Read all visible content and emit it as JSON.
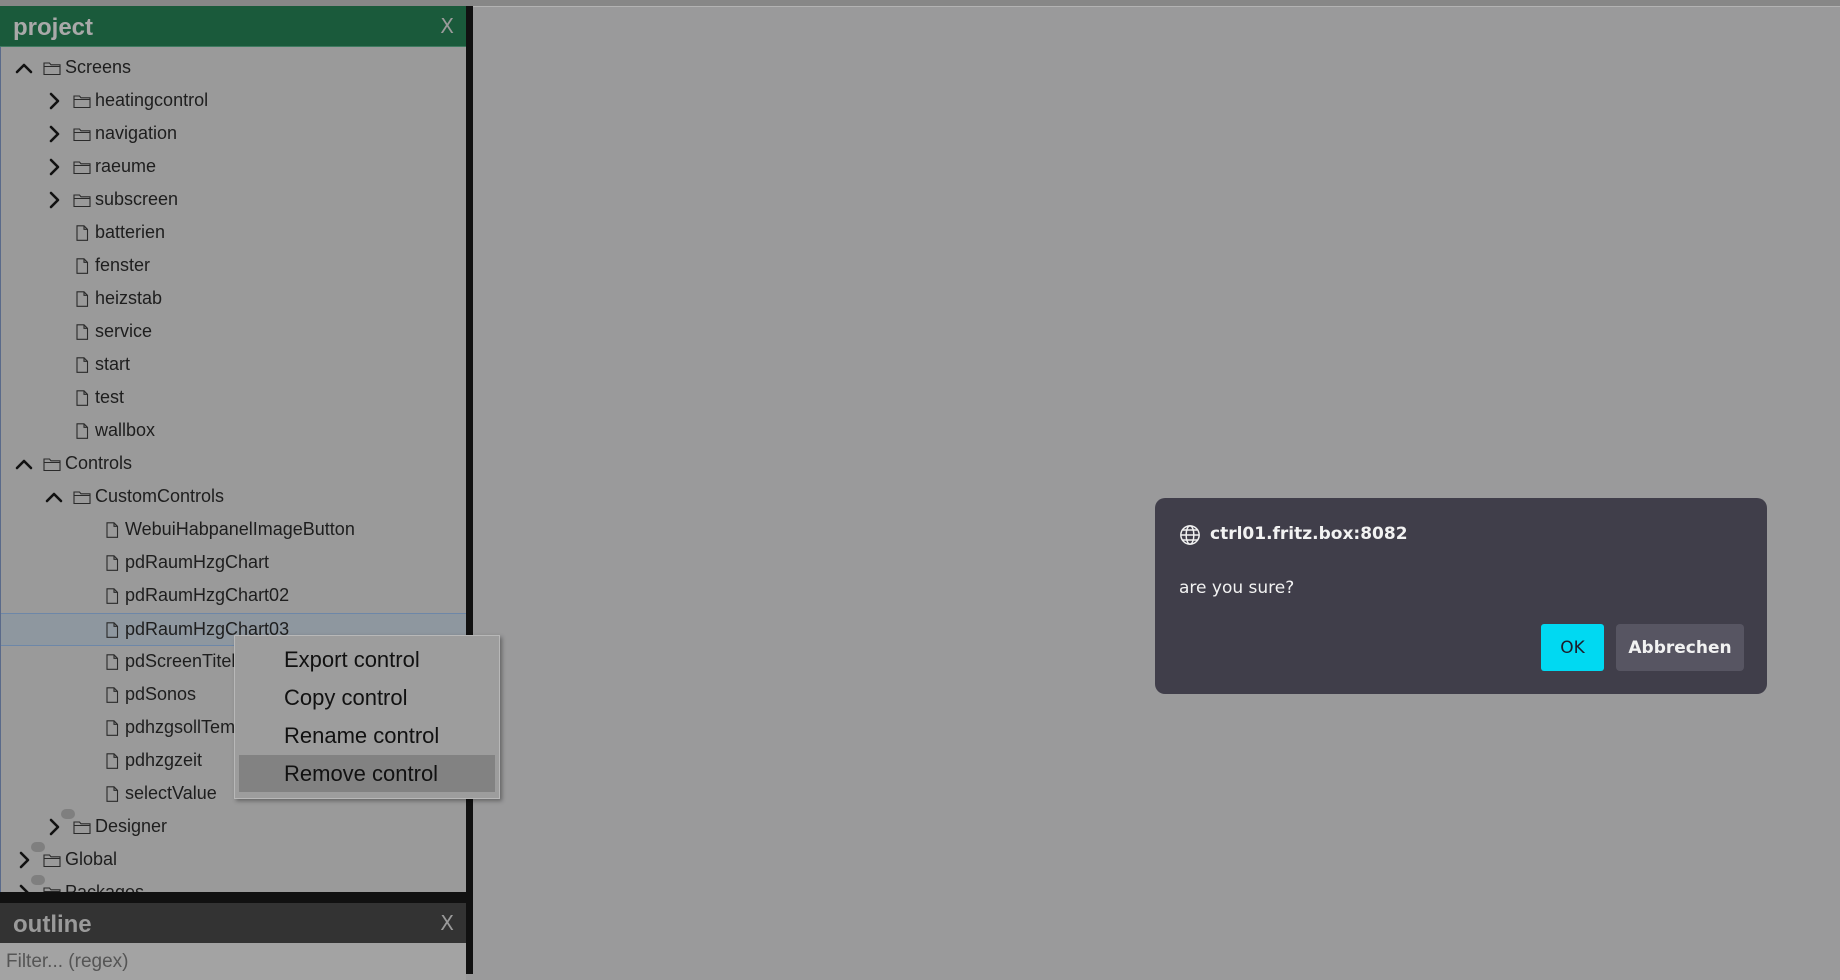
{
  "project_panel": {
    "title": "project",
    "close_label": "X",
    "tree": {
      "screens": {
        "label": "Screens",
        "expanded": true
      },
      "screens_folders": [
        "heatingcontrol",
        "navigation",
        "raeume",
        "subscreen"
      ],
      "screens_files": [
        "batterien",
        "fenster",
        "heizstab",
        "service",
        "start",
        "test",
        "wallbox"
      ],
      "controls": {
        "label": "Controls",
        "expanded": true
      },
      "custom_controls": {
        "label": "CustomControls",
        "expanded": true
      },
      "custom_controls_files": [
        "WebuiHabpanelImageButton",
        "pdRaumHzgChart",
        "pdRaumHzgChart02",
        "pdRaumHzgChart03",
        "pdScreenTitel",
        "pdSonos",
        "pdhzgsollTemp",
        "pdhzgzeit",
        "selectValue"
      ],
      "selected_item": "pdRaumHzgChart03",
      "designer": {
        "label": "Designer"
      },
      "global": {
        "label": "Global"
      },
      "packages": {
        "label": "Packages"
      }
    }
  },
  "outline_panel": {
    "title": "outline",
    "close_label": "X",
    "filter_placeholder": "Filter... (regex)"
  },
  "context_menu": {
    "items": [
      "Export control",
      "Copy control",
      "Rename control",
      "Remove control"
    ],
    "highlighted": "Remove control"
  },
  "dialog": {
    "host": "ctrl01.fritz.box:8082",
    "message": "are you sure?",
    "ok_label": "OK",
    "cancel_label": "Abbrechen"
  },
  "colors": {
    "project_header": "#1a5a3b",
    "overlay_background": "#9a9a9b",
    "dialog_background": "#403e4a",
    "ok_button": "#00d9f2"
  }
}
